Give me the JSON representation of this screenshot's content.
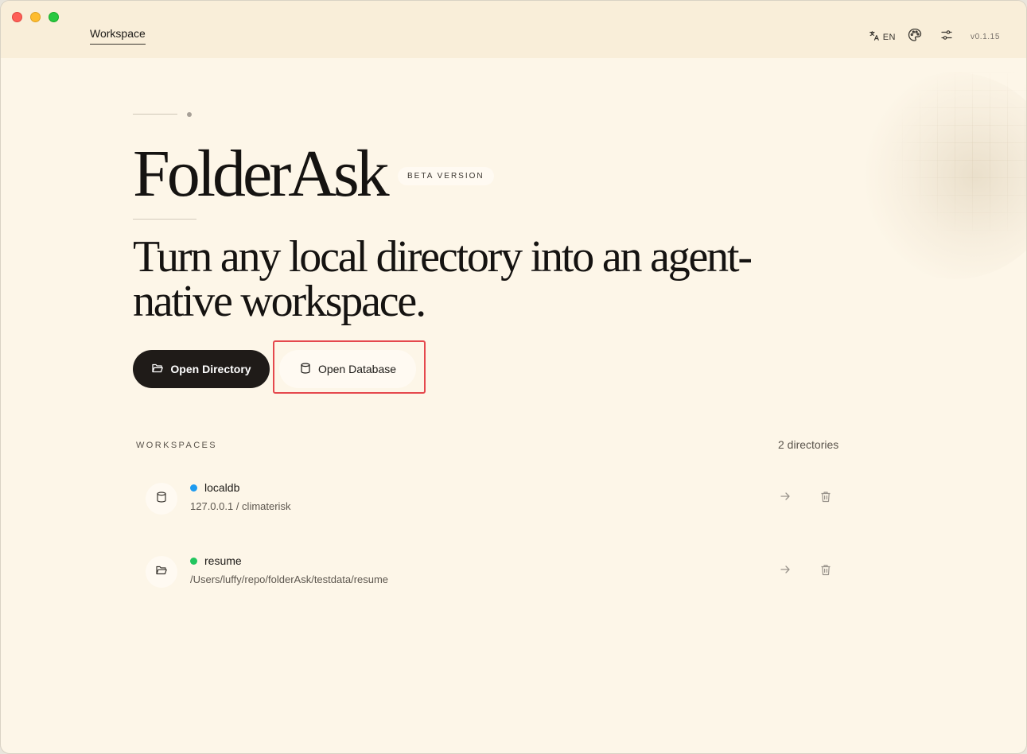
{
  "header": {
    "tab_label": "Workspace",
    "language": "EN",
    "version": "v0.1.15",
    "icons": [
      "translate-icon",
      "palette-icon",
      "settings-sliders-icon"
    ]
  },
  "hero": {
    "brand": "FolderAsk",
    "badge": "BETA VERSION",
    "tagline_line1": "Turn any local directory into an agent-",
    "tagline_line2": "native workspace."
  },
  "actions": {
    "open_directory": "Open Directory",
    "open_database": "Open Database"
  },
  "workspaces": {
    "label": "WORKSPACES",
    "count": "2 directories",
    "items": [
      {
        "name": "localdb",
        "path": "127.0.0.1 / climaterisk",
        "type": "database",
        "status_color": "#1e9bf0"
      },
      {
        "name": "resume",
        "path": "/Users/luffy/repo/folderAsk/testdata/resume",
        "type": "folder",
        "status_color": "#22c55e"
      }
    ]
  },
  "colors": {
    "background": "#fdf6e8",
    "titlebar": "#f9eed9",
    "primary_button": "#1f1b18",
    "highlight_border": "#e5484d"
  }
}
